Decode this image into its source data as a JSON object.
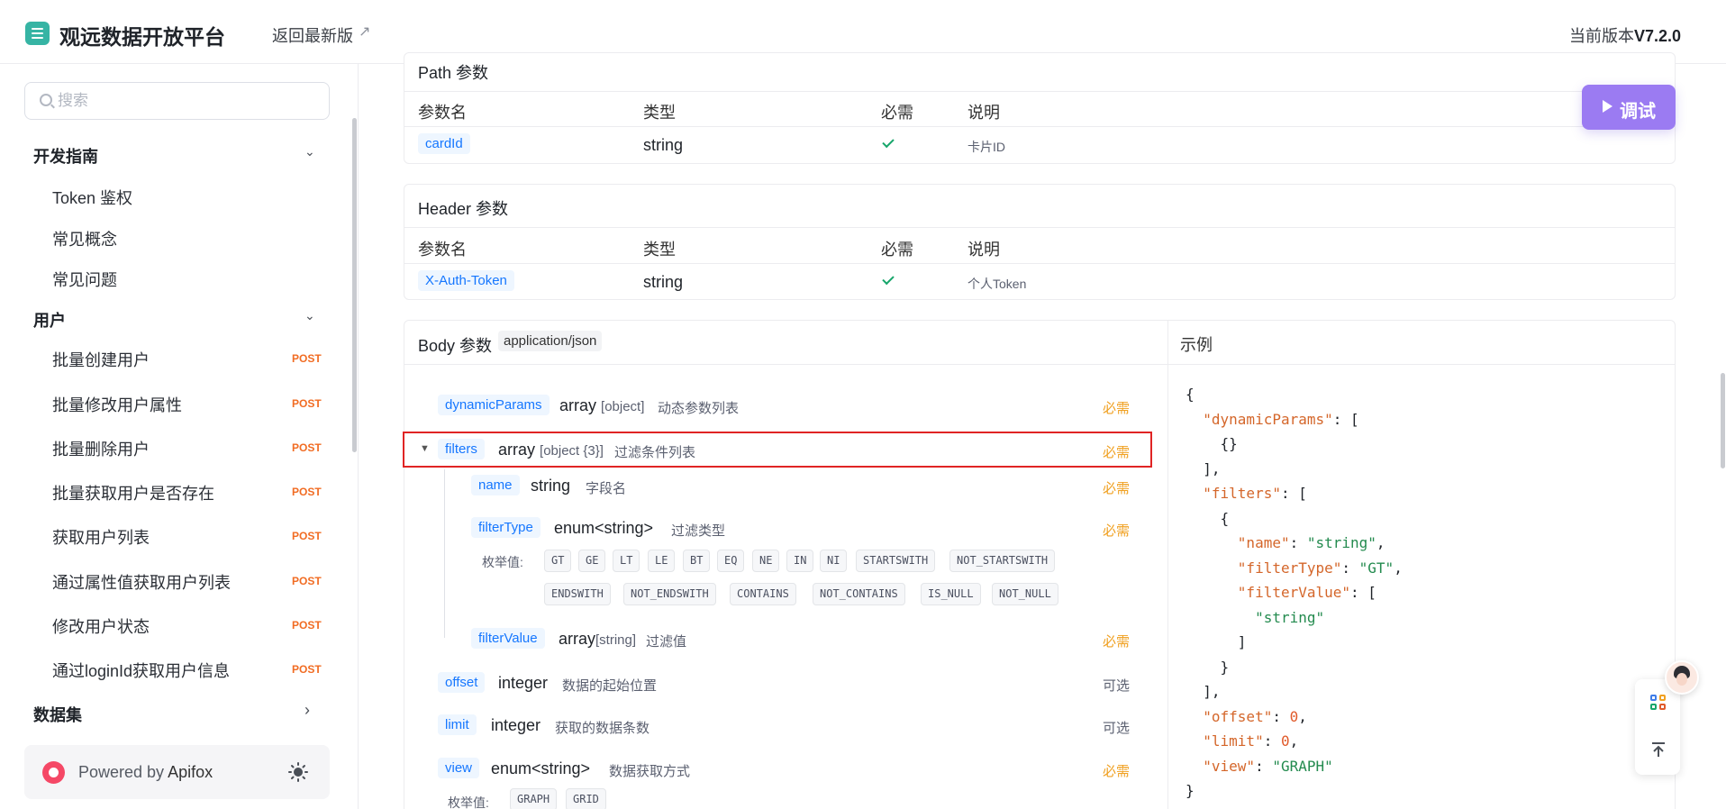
{
  "header": {
    "brand": "观远数据开放平台",
    "back_link": "返回最新版",
    "back_arrow": "↗",
    "version_label": "当前版本",
    "version_value": "V7.2.0"
  },
  "sidebar": {
    "search_placeholder": "搜索",
    "groups": [
      {
        "label": "开发指南",
        "chevron": "⌄",
        "items": [
          {
            "label": "Token 鉴权"
          },
          {
            "label": "常见概念"
          },
          {
            "label": "常见问题"
          }
        ]
      },
      {
        "label": "用户",
        "chevron": "⌄",
        "items": [
          {
            "label": "批量创建用户",
            "method": "POST"
          },
          {
            "label": "批量修改用户属性",
            "method": "POST"
          },
          {
            "label": "批量删除用户",
            "method": "POST"
          },
          {
            "label": "批量获取用户是否存在",
            "method": "POST"
          },
          {
            "label": "获取用户列表",
            "method": "POST"
          },
          {
            "label": "通过属性值获取用户列表",
            "method": "POST"
          },
          {
            "label": "修改用户状态",
            "method": "POST"
          },
          {
            "label": "通过loginId获取用户信息",
            "method": "POST"
          }
        ]
      },
      {
        "label": "数据集",
        "chevron": "›",
        "items": []
      }
    ],
    "powered_prefix": "Powered by ",
    "powered_brand": "Apifox"
  },
  "debug_button": "调试",
  "path_params": {
    "title": "Path 参数",
    "columns": [
      "参数名",
      "类型",
      "必需",
      "说明"
    ],
    "rows": [
      {
        "name": "cardId",
        "type": "string",
        "required": true,
        "desc": "卡片ID"
      }
    ]
  },
  "header_params": {
    "title": "Header 参数",
    "columns": [
      "参数名",
      "类型",
      "必需",
      "说明"
    ],
    "rows": [
      {
        "name": "X-Auth-Token",
        "type": "string",
        "required": true,
        "desc": "个人Token"
      }
    ]
  },
  "body_params": {
    "title": "Body 参数",
    "content_type": "application/json",
    "required_label": "必需",
    "optional_label": "可选",
    "enum_label": "枚举值:",
    "fields": {
      "dynamicParams": {
        "name": "dynamicParams",
        "type": "array",
        "type_detail": "[object]",
        "desc": "动态参数列表"
      },
      "filters": {
        "toggle": "▼",
        "name": "filters",
        "type": "array",
        "type_detail": "[object {3}]",
        "desc": "过滤条件列表"
      },
      "name": {
        "name": "name",
        "type": "string",
        "desc": "字段名"
      },
      "filterType": {
        "name": "filterType",
        "type": "enum<string>",
        "desc": "过滤类型",
        "enums": [
          "GT",
          "GE",
          "LT",
          "LE",
          "BT",
          "EQ",
          "NE",
          "IN",
          "NI",
          "STARTSWITH",
          "NOT_STARTSWITH",
          "ENDSWITH",
          "NOT_ENDSWITH",
          "CONTAINS",
          "NOT_CONTAINS",
          "IS_NULL",
          "NOT_NULL"
        ]
      },
      "filterValue": {
        "name": "filterValue",
        "type": "array",
        "type_detail": "[string]",
        "desc": "过滤值"
      },
      "offset": {
        "name": "offset",
        "type": "integer",
        "desc": "数据的起始位置"
      },
      "limit": {
        "name": "limit",
        "type": "integer",
        "desc": "获取的数据条数"
      },
      "view": {
        "name": "view",
        "type": "enum<string>",
        "desc": "数据获取方式",
        "enums": [
          "GRAPH",
          "GRID"
        ]
      }
    }
  },
  "example": {
    "title": "示例",
    "keys": {
      "dynamicParams": "\"dynamicParams\"",
      "filters": "\"filters\"",
      "name": "\"name\"",
      "filterType": "\"filterType\"",
      "filterValue": "\"filterValue\"",
      "offset": "\"offset\"",
      "limit": "\"limit\"",
      "view": "\"view\""
    },
    "values": {
      "name": "\"string\"",
      "filterType": "\"GT\"",
      "filterValueItem": "\"string\"",
      "offset": "0",
      "limit": "0",
      "view": "\"GRAPH\""
    }
  }
}
